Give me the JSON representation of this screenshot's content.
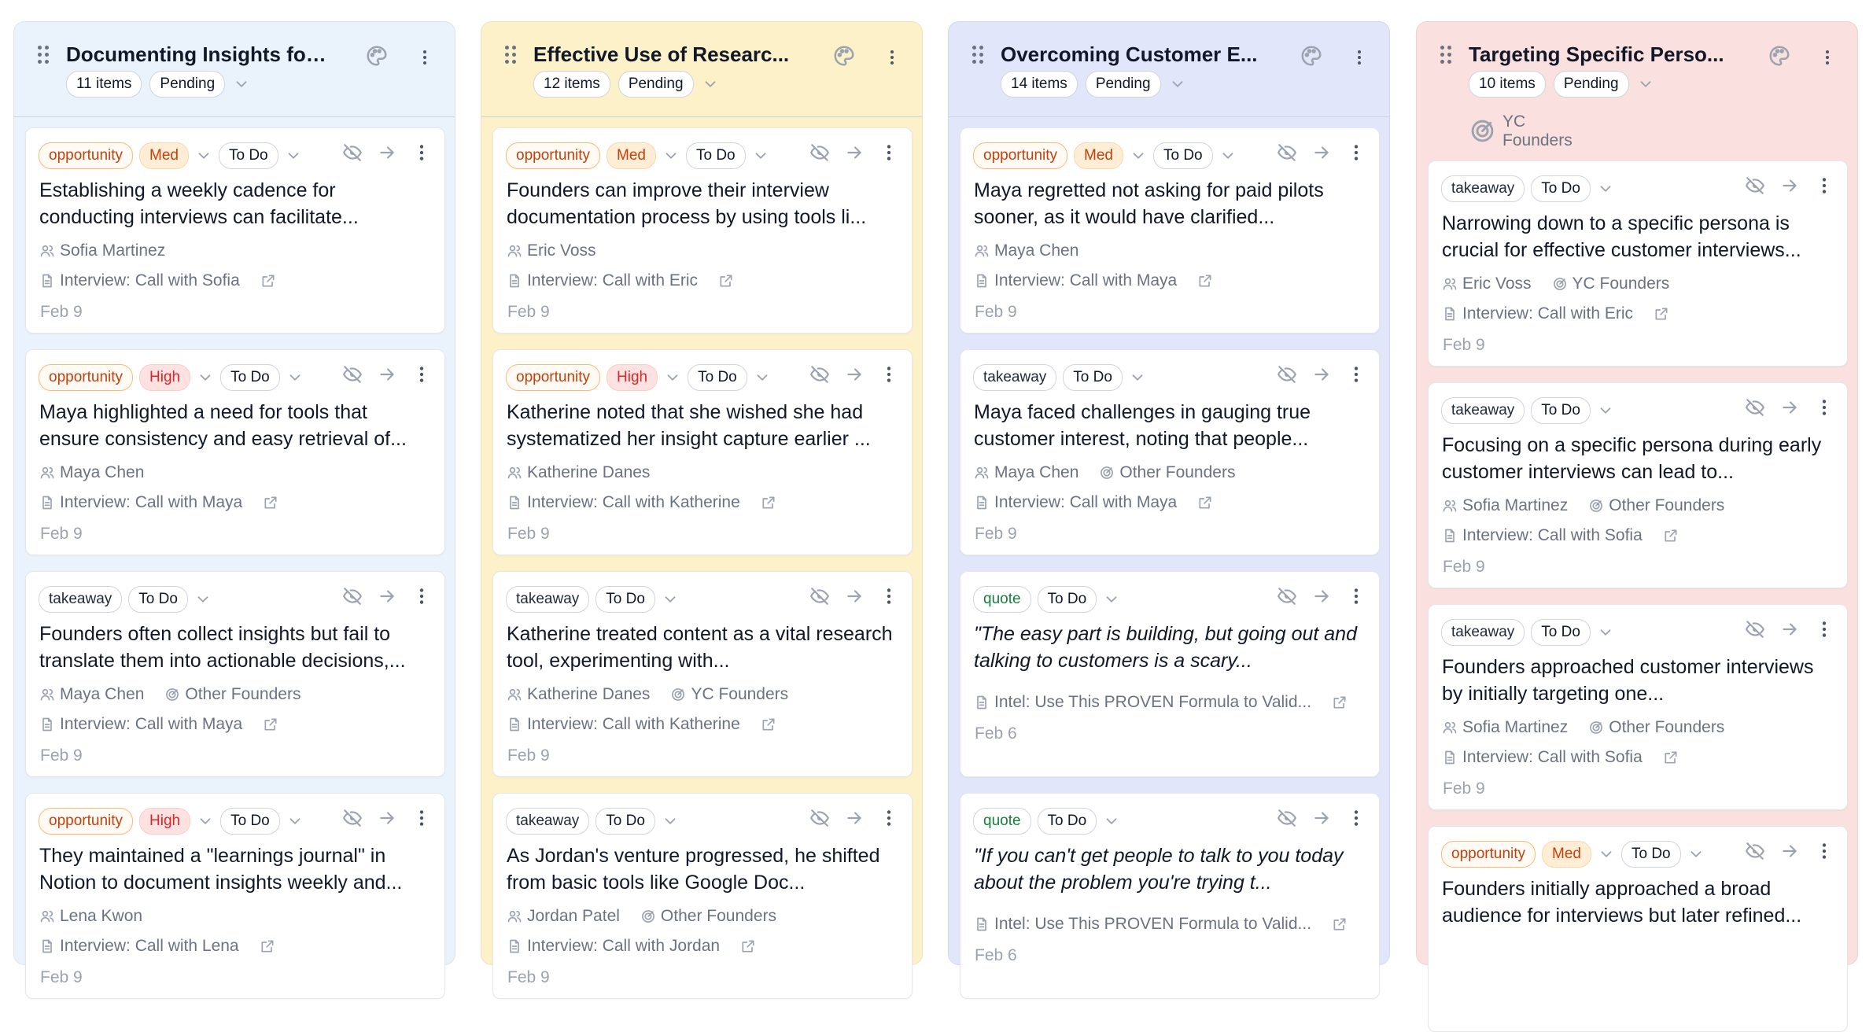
{
  "columns": [
    {
      "title": "Documenting Insights for ...",
      "count": "11 items",
      "status": "Pending",
      "tag": "",
      "bg": "#eaf2fc",
      "cards": [
        {
          "type": "opportunity",
          "priority": "Med",
          "status": "To Do",
          "text": "Establishing a weekly cadence for conducting interviews can facilitate...",
          "person": "Sofia Martinez",
          "group": "",
          "source": "Interview: Call with Sofia",
          "date": "Feb 9"
        },
        {
          "type": "opportunity",
          "priority": "High",
          "status": "To Do",
          "text": "Maya highlighted a need for tools that ensure consistency and easy retrieval of...",
          "person": "Maya Chen",
          "group": "",
          "source": "Interview: Call with Maya",
          "date": "Feb 9"
        },
        {
          "type": "takeaway",
          "priority": "",
          "status": "To Do",
          "text": "Founders often collect insights but fail to translate them into actionable decisions,...",
          "person": "Maya Chen",
          "group": "Other Founders",
          "source": "Interview: Call with Maya",
          "date": "Feb 9"
        },
        {
          "type": "opportunity",
          "priority": "High",
          "status": "To Do",
          "text": "They maintained a \"learnings journal\" in Notion to document insights weekly and...",
          "person": "Lena Kwon",
          "group": "",
          "source": "Interview: Call with Lena",
          "date": "Feb 9"
        }
      ]
    },
    {
      "title": "Effective Use of Researc...",
      "count": "12 items",
      "status": "Pending",
      "tag": "",
      "bg": "#fcf1c9",
      "cards": [
        {
          "type": "opportunity",
          "priority": "Med",
          "status": "To Do",
          "text": "Founders can improve their interview documentation process by using tools li...",
          "person": "Eric Voss",
          "group": "",
          "source": "Interview: Call with Eric",
          "date": "Feb 9"
        },
        {
          "type": "opportunity",
          "priority": "High",
          "status": "To Do",
          "text": "Katherine noted that she wished she had systematized her insight capture earlier ...",
          "person": "Katherine Danes",
          "group": "",
          "source": "Interview: Call with Katherine",
          "date": "Feb 9"
        },
        {
          "type": "takeaway",
          "priority": "",
          "status": "To Do",
          "text": "Katherine treated content as a vital research tool, experimenting with...",
          "person": "Katherine Danes",
          "group": "YC Founders",
          "source": "Interview: Call with Katherine",
          "date": "Feb 9"
        },
        {
          "type": "takeaway",
          "priority": "",
          "status": "To Do",
          "text": "As Jordan's venture progressed, he shifted from basic tools like Google Doc...",
          "person": "Jordan Patel",
          "group": "Other Founders",
          "source": "Interview: Call with Jordan",
          "date": "Feb 9"
        }
      ]
    },
    {
      "title": "Overcoming Customer E...",
      "count": "14 items",
      "status": "Pending",
      "tag": "",
      "bg": "#e2e6fb",
      "cards": [
        {
          "type": "opportunity",
          "priority": "Med",
          "status": "To Do",
          "text": "Maya regretted not asking for paid pilots sooner, as it would have clarified...",
          "person": "Maya Chen",
          "group": "",
          "source": "Interview: Call with Maya",
          "date": "Feb 9"
        },
        {
          "type": "takeaway",
          "priority": "",
          "status": "To Do",
          "text": "Maya faced challenges in gauging true customer interest, noting that people...",
          "person": "Maya Chen",
          "group": "Other Founders",
          "source": "Interview: Call with Maya",
          "date": "Feb 9"
        },
        {
          "type": "quote",
          "priority": "",
          "status": "To Do",
          "text": "\"The easy part is building, but going out and talking to customers is a scary...",
          "person": "",
          "group": "",
          "source": "Intel: Use This PROVEN Formula to Valid...",
          "date": "Feb 6"
        },
        {
          "type": "quote",
          "priority": "",
          "status": "To Do",
          "text": "\"If you can't get people to talk to you today about the problem you're trying t...",
          "person": "",
          "group": "",
          "source": "Intel: Use This PROVEN Formula to Valid...",
          "date": "Feb 6"
        }
      ]
    },
    {
      "title": "Targeting Specific Perso...",
      "count": "10 items",
      "status": "Pending",
      "tag": "YC Founders",
      "bg": "#fbe0e0",
      "cards": [
        {
          "type": "takeaway",
          "priority": "",
          "status": "To Do",
          "text": "Narrowing down to a specific persona is crucial for effective customer interviews...",
          "person": "Eric Voss",
          "group": "YC Founders",
          "source": "Interview: Call with Eric",
          "date": "Feb 9"
        },
        {
          "type": "takeaway",
          "priority": "",
          "status": "To Do",
          "text": "Focusing on a specific persona during early customer interviews can lead to...",
          "person": "Sofia Martinez",
          "group": "Other Founders",
          "source": "Interview: Call with Sofia",
          "date": "Feb 9"
        },
        {
          "type": "takeaway",
          "priority": "",
          "status": "To Do",
          "text": "Founders approached customer interviews by initially targeting one...",
          "person": "Sofia Martinez",
          "group": "Other Founders",
          "source": "Interview: Call with Sofia",
          "date": "Feb 9"
        },
        {
          "type": "opportunity",
          "priority": "Med",
          "status": "To Do",
          "text": "Founders initially approached a broad audience for interviews but later refined...",
          "person": "",
          "group": "",
          "source": "",
          "date": ""
        }
      ]
    }
  ],
  "icons": {
    "drag": "drag-handle-icon",
    "palette": "palette-icon",
    "menu": "more-vertical-icon",
    "chevron": "chevron-down-icon",
    "hide": "eye-off-icon",
    "arrow": "arrow-right-icon",
    "person": "users-icon",
    "group": "target-icon",
    "doc": "document-icon",
    "external": "external-link-icon"
  }
}
